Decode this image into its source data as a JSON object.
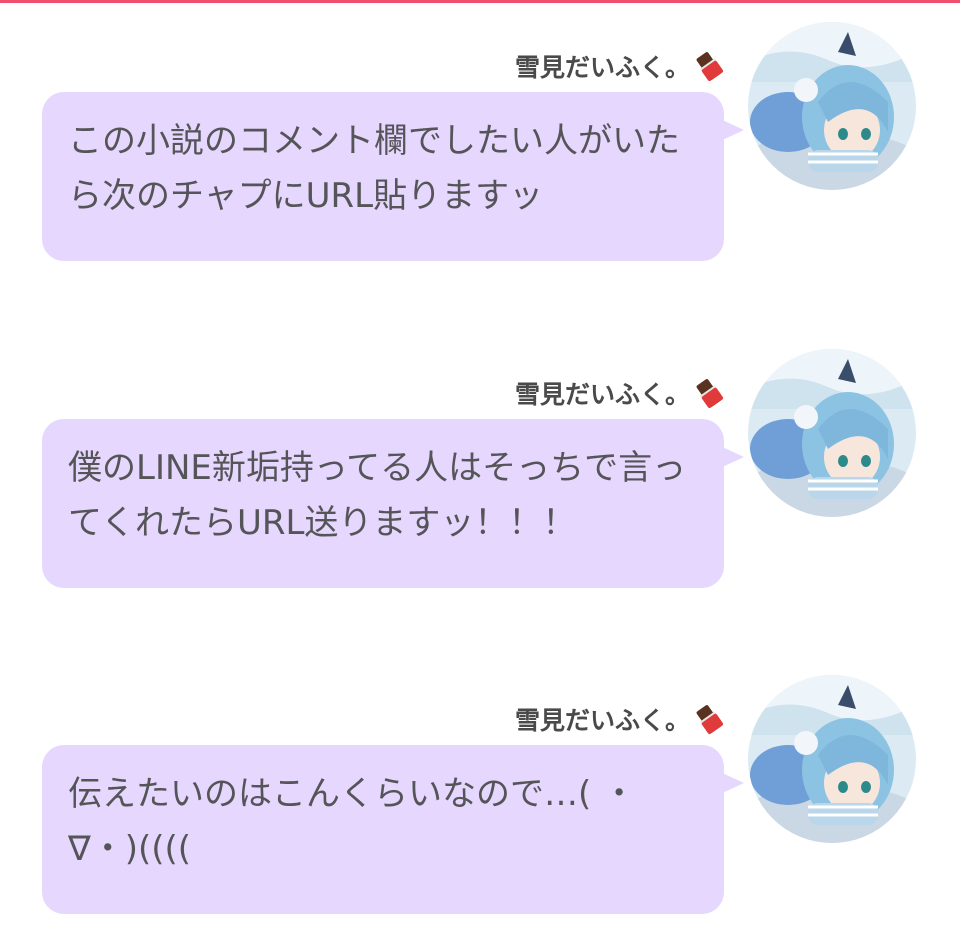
{
  "thread": {
    "messages": [
      {
        "sender": "雪見だいふく。",
        "sender_icon": "chocolate-bar-icon",
        "text": "この小説のコメント欄でしたい人がいたら次のチャプにURL貼りますッ"
      },
      {
        "sender": "雪見だいふく。",
        "sender_icon": "chocolate-bar-icon",
        "text": "僕のLINE新垢持ってる人はそっちで言ってくれたらURL送りますッ！！！"
      },
      {
        "sender": "雪見だいふく。",
        "sender_icon": "chocolate-bar-icon",
        "text": "伝えたいのはこんくらいなので…( ・∇・)(((("
      }
    ]
  },
  "colors": {
    "accent_line": "#f0506e",
    "bubble": "#e6d7ff",
    "text": "#555558"
  }
}
